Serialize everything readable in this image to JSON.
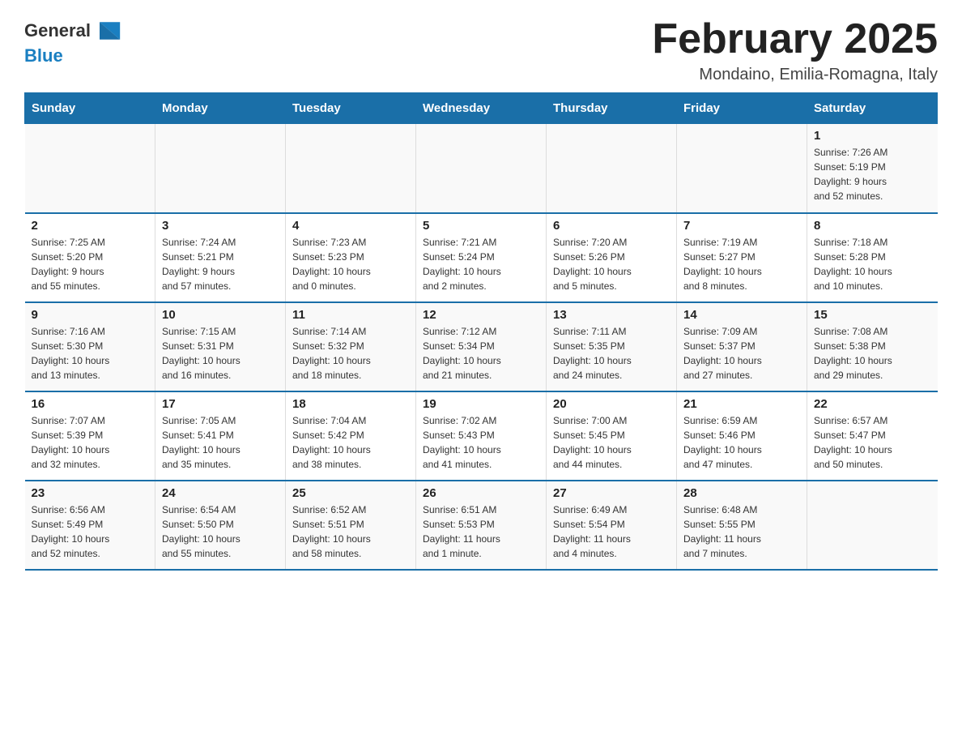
{
  "header": {
    "logo_text_general": "General",
    "logo_text_blue": "Blue",
    "month_title": "February 2025",
    "location": "Mondaino, Emilia-Romagna, Italy"
  },
  "calendar": {
    "days_of_week": [
      "Sunday",
      "Monday",
      "Tuesday",
      "Wednesday",
      "Thursday",
      "Friday",
      "Saturday"
    ],
    "weeks": [
      {
        "days": [
          {
            "number": "",
            "info": ""
          },
          {
            "number": "",
            "info": ""
          },
          {
            "number": "",
            "info": ""
          },
          {
            "number": "",
            "info": ""
          },
          {
            "number": "",
            "info": ""
          },
          {
            "number": "",
            "info": ""
          },
          {
            "number": "1",
            "info": "Sunrise: 7:26 AM\nSunset: 5:19 PM\nDaylight: 9 hours\nand 52 minutes."
          }
        ]
      },
      {
        "days": [
          {
            "number": "2",
            "info": "Sunrise: 7:25 AM\nSunset: 5:20 PM\nDaylight: 9 hours\nand 55 minutes."
          },
          {
            "number": "3",
            "info": "Sunrise: 7:24 AM\nSunset: 5:21 PM\nDaylight: 9 hours\nand 57 minutes."
          },
          {
            "number": "4",
            "info": "Sunrise: 7:23 AM\nSunset: 5:23 PM\nDaylight: 10 hours\nand 0 minutes."
          },
          {
            "number": "5",
            "info": "Sunrise: 7:21 AM\nSunset: 5:24 PM\nDaylight: 10 hours\nand 2 minutes."
          },
          {
            "number": "6",
            "info": "Sunrise: 7:20 AM\nSunset: 5:26 PM\nDaylight: 10 hours\nand 5 minutes."
          },
          {
            "number": "7",
            "info": "Sunrise: 7:19 AM\nSunset: 5:27 PM\nDaylight: 10 hours\nand 8 minutes."
          },
          {
            "number": "8",
            "info": "Sunrise: 7:18 AM\nSunset: 5:28 PM\nDaylight: 10 hours\nand 10 minutes."
          }
        ]
      },
      {
        "days": [
          {
            "number": "9",
            "info": "Sunrise: 7:16 AM\nSunset: 5:30 PM\nDaylight: 10 hours\nand 13 minutes."
          },
          {
            "number": "10",
            "info": "Sunrise: 7:15 AM\nSunset: 5:31 PM\nDaylight: 10 hours\nand 16 minutes."
          },
          {
            "number": "11",
            "info": "Sunrise: 7:14 AM\nSunset: 5:32 PM\nDaylight: 10 hours\nand 18 minutes."
          },
          {
            "number": "12",
            "info": "Sunrise: 7:12 AM\nSunset: 5:34 PM\nDaylight: 10 hours\nand 21 minutes."
          },
          {
            "number": "13",
            "info": "Sunrise: 7:11 AM\nSunset: 5:35 PM\nDaylight: 10 hours\nand 24 minutes."
          },
          {
            "number": "14",
            "info": "Sunrise: 7:09 AM\nSunset: 5:37 PM\nDaylight: 10 hours\nand 27 minutes."
          },
          {
            "number": "15",
            "info": "Sunrise: 7:08 AM\nSunset: 5:38 PM\nDaylight: 10 hours\nand 29 minutes."
          }
        ]
      },
      {
        "days": [
          {
            "number": "16",
            "info": "Sunrise: 7:07 AM\nSunset: 5:39 PM\nDaylight: 10 hours\nand 32 minutes."
          },
          {
            "number": "17",
            "info": "Sunrise: 7:05 AM\nSunset: 5:41 PM\nDaylight: 10 hours\nand 35 minutes."
          },
          {
            "number": "18",
            "info": "Sunrise: 7:04 AM\nSunset: 5:42 PM\nDaylight: 10 hours\nand 38 minutes."
          },
          {
            "number": "19",
            "info": "Sunrise: 7:02 AM\nSunset: 5:43 PM\nDaylight: 10 hours\nand 41 minutes."
          },
          {
            "number": "20",
            "info": "Sunrise: 7:00 AM\nSunset: 5:45 PM\nDaylight: 10 hours\nand 44 minutes."
          },
          {
            "number": "21",
            "info": "Sunrise: 6:59 AM\nSunset: 5:46 PM\nDaylight: 10 hours\nand 47 minutes."
          },
          {
            "number": "22",
            "info": "Sunrise: 6:57 AM\nSunset: 5:47 PM\nDaylight: 10 hours\nand 50 minutes."
          }
        ]
      },
      {
        "days": [
          {
            "number": "23",
            "info": "Sunrise: 6:56 AM\nSunset: 5:49 PM\nDaylight: 10 hours\nand 52 minutes."
          },
          {
            "number": "24",
            "info": "Sunrise: 6:54 AM\nSunset: 5:50 PM\nDaylight: 10 hours\nand 55 minutes."
          },
          {
            "number": "25",
            "info": "Sunrise: 6:52 AM\nSunset: 5:51 PM\nDaylight: 10 hours\nand 58 minutes."
          },
          {
            "number": "26",
            "info": "Sunrise: 6:51 AM\nSunset: 5:53 PM\nDaylight: 11 hours\nand 1 minute."
          },
          {
            "number": "27",
            "info": "Sunrise: 6:49 AM\nSunset: 5:54 PM\nDaylight: 11 hours\nand 4 minutes."
          },
          {
            "number": "28",
            "info": "Sunrise: 6:48 AM\nSunset: 5:55 PM\nDaylight: 11 hours\nand 7 minutes."
          },
          {
            "number": "",
            "info": ""
          }
        ]
      }
    ]
  }
}
